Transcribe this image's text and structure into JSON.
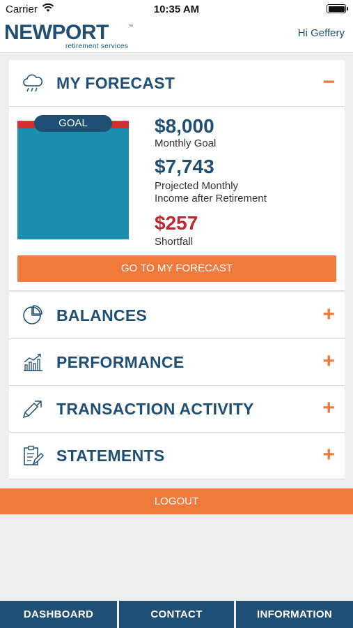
{
  "status_bar": {
    "carrier": "Carrier",
    "time": "10:35 AM"
  },
  "header": {
    "logo_text": "NEWPORT",
    "logo_sub": "retirement services",
    "logo_tm": "™",
    "greeting": "Hi Geffery"
  },
  "forecast": {
    "title": "MY FORECAST",
    "toggle": "−",
    "goal_tag": "GOAL",
    "monthly_goal_amount": "$8,000",
    "monthly_goal_label": "Monthly Goal",
    "projected_amount": "$7,743",
    "projected_label_line1": "Projected Monthly",
    "projected_label_line2": "Income after Retirement",
    "shortfall_amount": "$257",
    "shortfall_label": "Shortfall",
    "button": "GO TO MY FORECAST"
  },
  "sections": [
    {
      "title": "BALANCES",
      "toggle": "+",
      "icon": "pie-chart-icon"
    },
    {
      "title": "PERFORMANCE",
      "toggle": "+",
      "icon": "bar-chart-trend-icon"
    },
    {
      "title": "TRANSACTION ACTIVITY",
      "toggle": "+",
      "icon": "pencil-arrow-icon"
    },
    {
      "title": "STATEMENTS",
      "toggle": "+",
      "icon": "clipboard-pen-icon"
    }
  ],
  "logout": "LOGOUT",
  "tabs": [
    "DASHBOARD",
    "CONTACT",
    "INFORMATION"
  ],
  "colors": {
    "brand_blue": "#1f4f74",
    "accent_orange": "#ef7a3b",
    "goal_teal": "#1c8fb0",
    "shortfall_red": "#c0262d"
  }
}
